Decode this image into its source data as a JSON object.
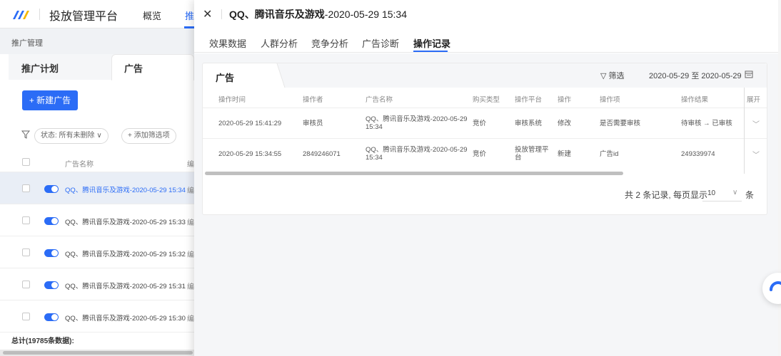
{
  "app": {
    "brand": "投放管理平台",
    "nav": [
      "概览",
      "推"
    ],
    "breadcrumb": "推广管理",
    "left_tabs": [
      "推广计划",
      "广告"
    ],
    "new_ad_button": "+ 新建广告",
    "filter_status_chip": "状态: 所有未删除 ∨",
    "filter_add_chip": "+ 添加筛选项",
    "table_header": "广告名称",
    "table_header_cut": "编",
    "rows": [
      {
        "name": "QQ、腾讯音乐及游戏-2020-05-29 15:34",
        "cut": "编",
        "selected": true
      },
      {
        "name": "QQ、腾讯音乐及游戏-2020-05-29 15:33",
        "cut": "编",
        "selected": false
      },
      {
        "name": "QQ、腾讯音乐及游戏-2020-05-29 15:32",
        "cut": "编",
        "selected": false
      },
      {
        "name": "QQ、腾讯音乐及游戏-2020-05-29 15:31",
        "cut": "编",
        "selected": false
      },
      {
        "name": "QQ、腾讯音乐及游戏-2020-05-29 15:30",
        "cut": "编",
        "selected": false
      }
    ],
    "total": "总计(19785条数据):"
  },
  "drawer": {
    "close_icon": "close-icon",
    "title_bold": "QQ、腾讯音乐及游戏",
    "title_rest": "-2020-05-29 15:34",
    "tabs": [
      "效果数据",
      "人群分析",
      "竞争分析",
      "广告诊断",
      "操作记录"
    ],
    "active_tab": "操作记录",
    "card_tab": "广告",
    "filter_label": "筛选",
    "date_range": "2020-05-29 至 2020-05-29",
    "columns": [
      "操作时间",
      "操作者",
      "广告名称",
      "购买类型",
      "操作平台",
      "操作",
      "操作项",
      "操作结果",
      "展开"
    ],
    "records": [
      {
        "time": "2020-05-29 15:41:29",
        "operator": "审核员",
        "ad_name_1": "QQ、腾讯音乐及游戏-2020-05-29",
        "ad_name_2": "15:34",
        "buy_type": "竞价",
        "platform_1": "审核系统",
        "platform_2": "",
        "action": "修改",
        "item": "是否需要审核",
        "result": "待审核 → 已审核"
      },
      {
        "time": "2020-05-29 15:34:55",
        "operator": "2849246071",
        "ad_name_1": "QQ、腾讯音乐及游戏-2020-05-29",
        "ad_name_2": "15:34",
        "buy_type": "竞价",
        "platform_1": "投放管理平",
        "platform_2": "台",
        "action": "新建",
        "item": "广告id",
        "result": "249339974"
      }
    ],
    "pager_text": "共 2 条记录, 每页显示",
    "page_size": "10",
    "pager_unit": "条"
  },
  "colors": {
    "accent": "#2b6cf6",
    "selected_row": "#e9eef6"
  }
}
